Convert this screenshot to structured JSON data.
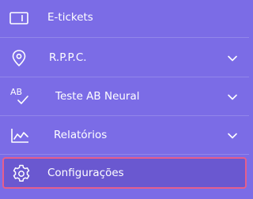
{
  "menu": {
    "items": [
      {
        "label": "E-tickets",
        "icon": "ticket-icon",
        "has_dropdown": false
      },
      {
        "label": "R.P.P.C.",
        "icon": "location-pin-icon",
        "has_dropdown": true
      },
      {
        "label": "Teste AB Neural",
        "icon": "ab-test-icon",
        "has_dropdown": true
      },
      {
        "label": "Relatórios",
        "icon": "chart-icon",
        "has_dropdown": true
      },
      {
        "label": "Configurações",
        "icon": "gear-icon",
        "has_dropdown": false,
        "active": true
      }
    ]
  },
  "colors": {
    "background": "#7B6CE6",
    "active_background": "#6A58D0",
    "active_border": "#E55E8C",
    "text": "#FFFFFF"
  }
}
